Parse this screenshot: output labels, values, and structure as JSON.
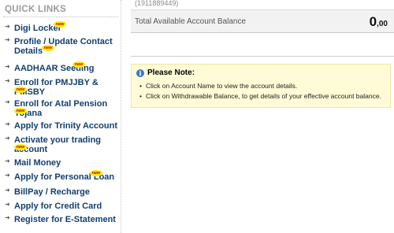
{
  "sidebar": {
    "title": "QUICK LINKS",
    "badge_text": "new",
    "items": [
      {
        "label": "Digi Locker",
        "new": true
      },
      {
        "label": "Profile / Update Contact Details",
        "new": true
      },
      {
        "label": "AADHAAR Seeding",
        "new": true
      },
      {
        "label": "Enroll for PMJJBY & PMSBY",
        "new": true
      },
      {
        "label": "Enroll for Atal Pension Yojana",
        "new": true
      },
      {
        "label": "Apply for Trinity Account",
        "new": false
      },
      {
        "label": "Activate your trading account",
        "new": true
      },
      {
        "label": "Mail Money",
        "new": false
      },
      {
        "label": "Apply for Personal Loan",
        "new": true
      },
      {
        "label": "BillPay / Recharge",
        "new": false
      },
      {
        "label": "Apply for Credit Card",
        "new": false
      },
      {
        "label": "Register for E-Statement",
        "new": false
      }
    ]
  },
  "account": {
    "number_fragment": "(1911889449)",
    "balance_label": "Total Available Account Balance",
    "balance_whole": "0",
    "balance_decimal": ",00"
  },
  "note": {
    "title": "Please Note:",
    "bullet": "•",
    "items": [
      "Click on Account Name to view the account details.",
      "Click on Withdrawable Balance, to get details of your effective account balance."
    ]
  },
  "colors": {
    "link": "#123f6e",
    "note_bg": "#fffbd6",
    "badge": "#ffee00",
    "info_icon": "#3a78c2"
  },
  "icons": {
    "list_arrow": "arrow-icon",
    "info": "info-icon"
  }
}
